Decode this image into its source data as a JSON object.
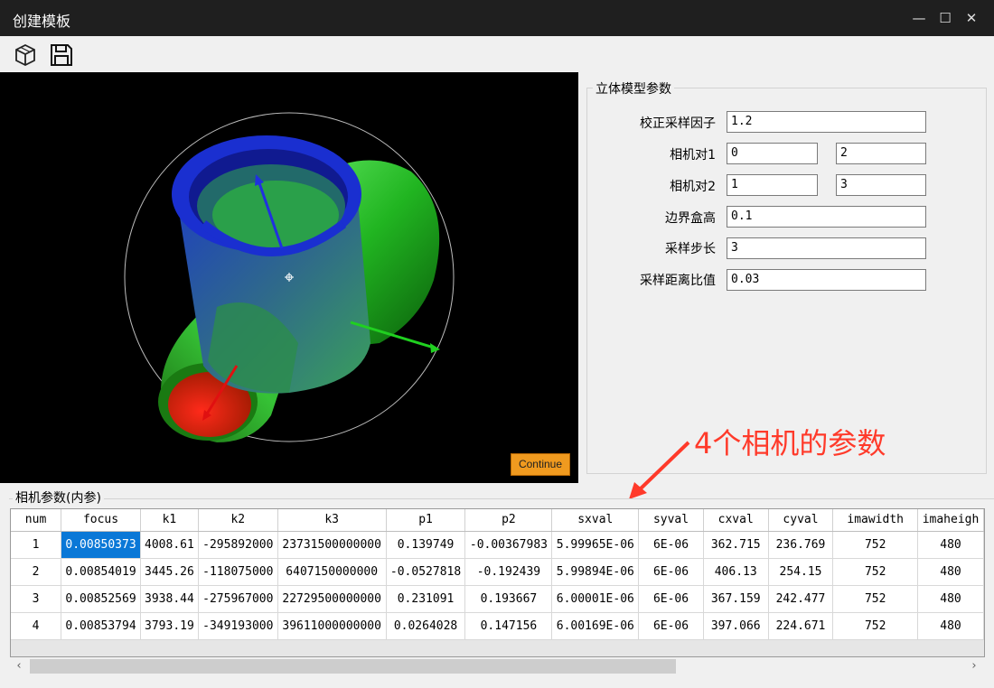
{
  "window": {
    "title": "创建模板",
    "minimize": "—",
    "maximize": "☐",
    "close": "✕"
  },
  "toolbar": {
    "icons": [
      "cube-icon",
      "save-icon"
    ]
  },
  "viewport": {
    "continue_label": "Continue"
  },
  "stereo_params": {
    "title": "立体模型参数",
    "fields": [
      {
        "label": "校正采样因子",
        "values": [
          "1.2"
        ]
      },
      {
        "label": "相机对1",
        "values": [
          "0",
          "2"
        ]
      },
      {
        "label": "相机对2",
        "values": [
          "1",
          "3"
        ]
      },
      {
        "label": "边界盒高",
        "values": [
          "0.1"
        ]
      },
      {
        "label": "采样步长",
        "values": [
          "3"
        ]
      },
      {
        "label": "采样距离比值",
        "values": [
          "0.03"
        ]
      }
    ]
  },
  "annotation": {
    "text": "4个相机的参数",
    "color": "#ff3a2a"
  },
  "camera_params": {
    "title": "相机参数(内参)",
    "columns": [
      "num",
      "focus",
      "k1",
      "k2",
      "k3",
      "p1",
      "p2",
      "sxval",
      "syval",
      "cxval",
      "cyval",
      "imawidth",
      "imaheigh"
    ],
    "rows": [
      [
        "1",
        "0.00850373",
        "4008.61",
        "-295892000",
        "23731500000000",
        "0.139749",
        "-0.00367983",
        "5.99965E-06",
        "6E-06",
        "362.715",
        "236.769",
        "752",
        "480"
      ],
      [
        "2",
        "0.00854019",
        "3445.26",
        "-118075000",
        "6407150000000",
        "-0.0527818",
        "-0.192439",
        "5.99894E-06",
        "6E-06",
        "406.13",
        "254.15",
        "752",
        "480"
      ],
      [
        "3",
        "0.00852569",
        "3938.44",
        "-275967000",
        "22729500000000",
        "0.231091",
        "0.193667",
        "6.00001E-06",
        "6E-06",
        "367.159",
        "242.477",
        "752",
        "480"
      ],
      [
        "4",
        "0.00853794",
        "3793.19",
        "-349193000",
        "39611000000000",
        "0.0264028",
        "0.147156",
        "6.00169E-06",
        "6E-06",
        "397.066",
        "224.671",
        "752",
        "480"
      ]
    ],
    "selected_cell": {
      "row": 0,
      "col": 1
    }
  },
  "colors": {
    "accent": "#0a78d7",
    "button": "#f09a1f",
    "titlebar": "#1f1f1f"
  }
}
